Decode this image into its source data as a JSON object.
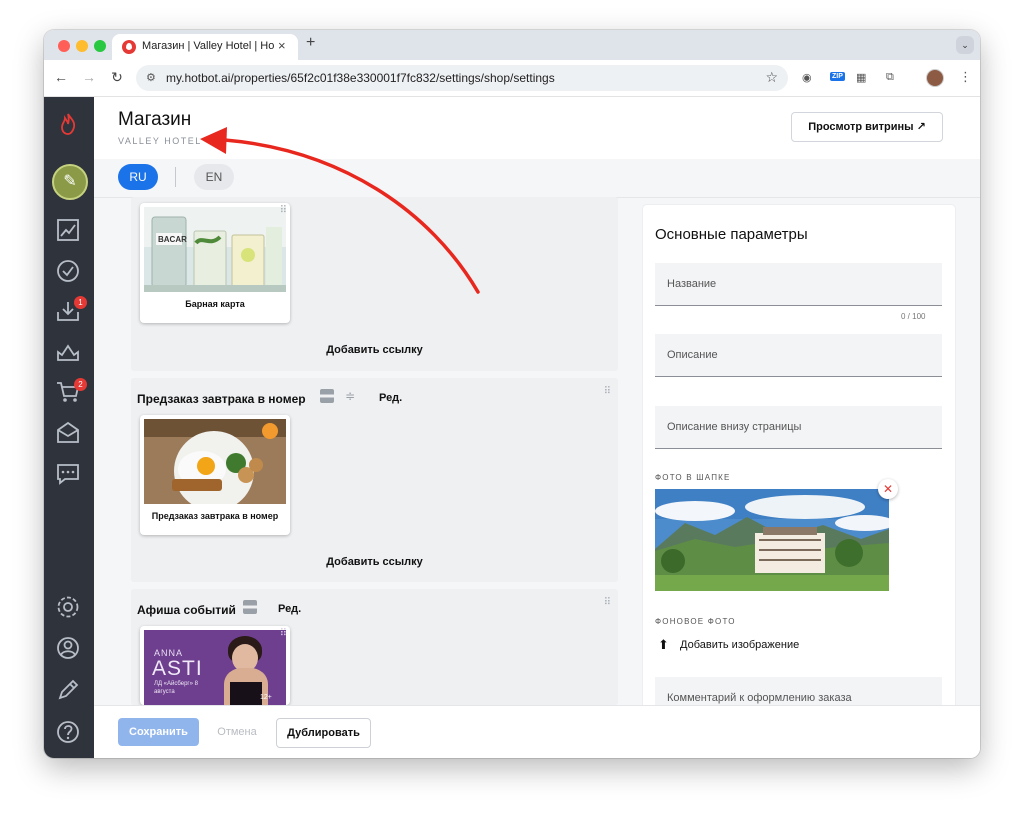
{
  "browser": {
    "tab_title": "Магазин | Valley Hotel | Hotbot",
    "tab_close": "×",
    "new_tab": "+",
    "url": "my.hotbot.ai/properties/65f2c01f38e330001f7fc832/settings/shop/settings",
    "zip_badge": "ZIP",
    "icons": [
      "back-icon",
      "forward-icon",
      "reload-icon",
      "site-settings-icon",
      "star-icon",
      "camera-icon",
      "qr-icon",
      "extensions-icon",
      "menu-icon"
    ]
  },
  "sidebar": {
    "inbox_badge": "1",
    "cart_badge": "2",
    "icons": [
      "flame-logo-icon",
      "analytics-icon",
      "check-icon",
      "inbox-icon",
      "crown-icon",
      "cart-icon",
      "mail-icon",
      "chat-icon",
      "settings-icon",
      "user-icon",
      "pencil-icon",
      "help-icon"
    ]
  },
  "header": {
    "title": "Магазин",
    "subtitle": "VALLEY HOTEL",
    "preview_button": "Просмотр витрины ↗"
  },
  "languages": {
    "ru": "RU",
    "en": "EN"
  },
  "sections": [
    {
      "title": "",
      "tile_label": "Барная карта",
      "add_link": "Добавить ссылку"
    },
    {
      "title": "Предзаказ завтрака в номер",
      "edit": "Ред.",
      "tile_label": "Предзаказ завтрака в номер",
      "add_link": "Добавить ссылку"
    },
    {
      "title": "Афиша событий",
      "edit": "Ред.",
      "poster_name": "ANNA",
      "poster_big": "ASTI",
      "poster_details": "ЛД «Айсберг» 8 августа",
      "poster_age": "12+"
    }
  ],
  "panel": {
    "title": "Основные параметры",
    "name_placeholder": "Название",
    "name_counter": "0 / 100",
    "description_placeholder": "Описание",
    "bottom_description_placeholder": "Описание внизу страницы",
    "header_photo_label": "ФОТО В ШАПКЕ",
    "remove_symbol": "✕",
    "background_photo_label": "ФОНОВОЕ ФОТО",
    "add_image": "Добавить изображение",
    "order_comment_placeholder": "Комментарий к оформлению заказа"
  },
  "footer": {
    "save": "Сохранить",
    "cancel": "Отмена",
    "duplicate": "Дублировать"
  },
  "colors": {
    "accent": "#1a73e8",
    "sidebar": "#2f343c",
    "badge": "#e53935",
    "annotation_arrow": "#e8281e"
  }
}
